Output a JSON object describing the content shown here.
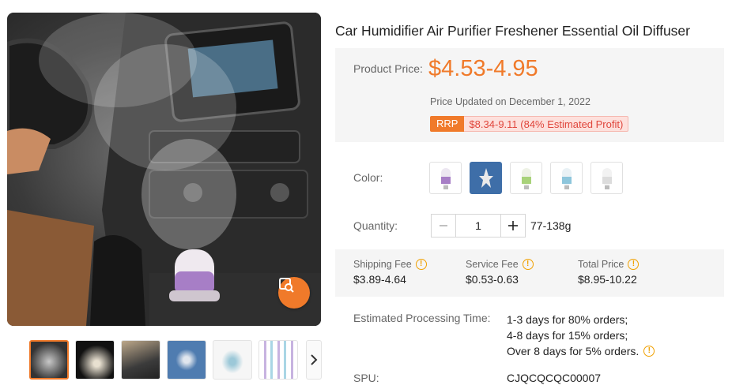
{
  "product": {
    "title": "Car Humidifier Air Purifier Freshener Essential Oil Diffuser"
  },
  "pricing": {
    "price_label": "Product Price:",
    "price": "$4.53-4.95",
    "updated": "Price Updated on December 1, 2022",
    "rrp_tag": "RRP",
    "rrp_value": "$8.34-9.11 (84% Estimated Profit)",
    "accent_color": "#f07a2a",
    "profit_color": "#e0463c"
  },
  "color": {
    "label": "Color:",
    "options": [
      "purple",
      "blue",
      "green",
      "light-blue",
      "white"
    ],
    "selected_index": 1
  },
  "quantity": {
    "label": "Quantity:",
    "value": "1",
    "weight": "77-138g"
  },
  "fees": {
    "shipping_label": "Shipping Fee",
    "shipping_value": "$3.89-4.64",
    "service_label": "Service Fee",
    "service_value": "$0.53-0.63",
    "total_label": "Total Price",
    "total_value": "$8.95-10.22"
  },
  "processing": {
    "label": "Estimated Processing Time:",
    "lines": [
      "1-3 days for 80% orders;",
      "4-8 days for 15% orders;",
      "Over 8 days for 5% orders."
    ]
  },
  "spu": {
    "label": "SPU:",
    "value": "CJQCQCQC00007"
  },
  "icons": {
    "zoom": "image-search-icon",
    "info": "info-icon",
    "next": "chevron-right-icon"
  }
}
